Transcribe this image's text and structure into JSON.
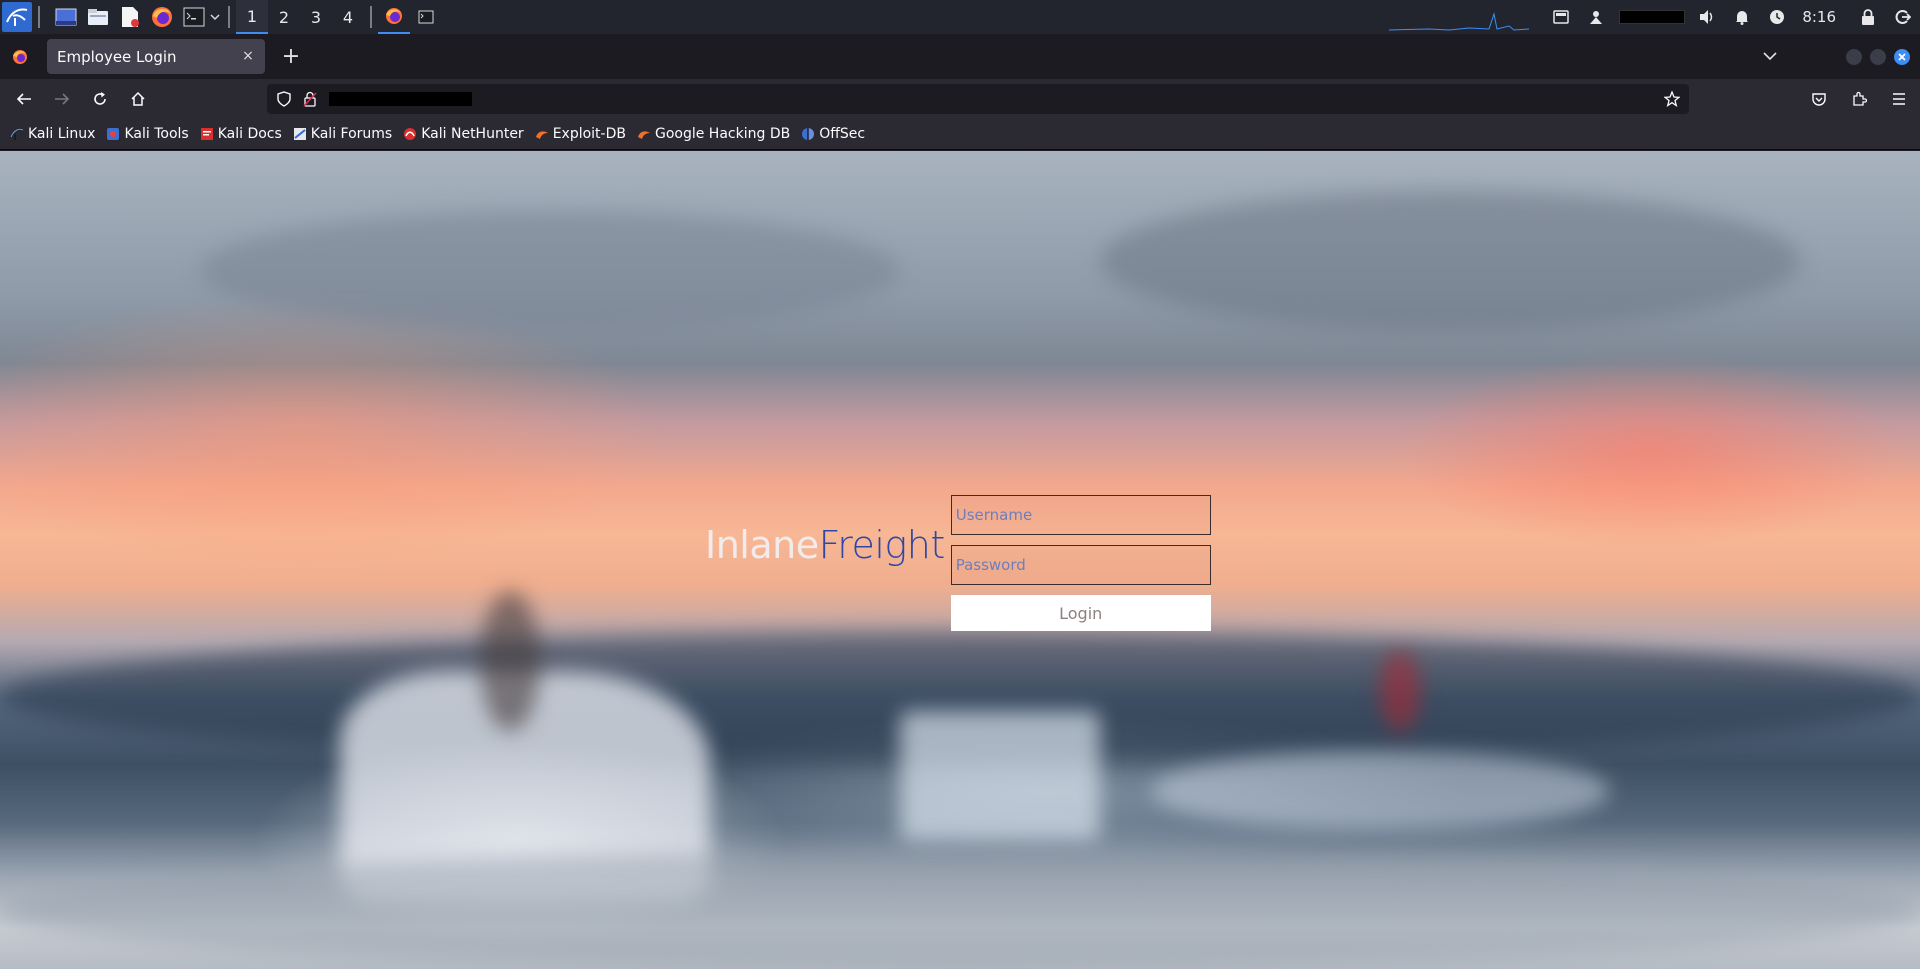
{
  "panel": {
    "workspaces": [
      "1",
      "2",
      "3",
      "4"
    ],
    "active_workspace": "1",
    "clock": "8:16",
    "icons": [
      "kali-menu-icon",
      "desktop-icon",
      "file-manager-icon",
      "text-editor-icon",
      "firefox-icon",
      "terminal-icon",
      "chevron-down-icon",
      "firefox-task-icon",
      "terminal-task-icon",
      "screenshot-icon",
      "vpn-icon",
      "volume-icon",
      "notification-bell-icon",
      "power-manager-icon",
      "lock-icon",
      "logout-icon"
    ],
    "accent": "#3d8df5"
  },
  "browser": {
    "tab_title": "Employee Login",
    "new_tab": "+",
    "close_glyph": "×",
    "bookmarks": [
      {
        "label": "Kali Linux",
        "icon": "kali-icon"
      },
      {
        "label": "Kali Tools",
        "icon": "kali-tools-icon"
      },
      {
        "label": "Kali Docs",
        "icon": "kali-docs-icon"
      },
      {
        "label": "Kali Forums",
        "icon": "kali-forums-icon"
      },
      {
        "label": "Kali NetHunter",
        "icon": "nethunter-icon"
      },
      {
        "label": "Exploit-DB",
        "icon": "exploit-db-icon"
      },
      {
        "label": "Google Hacking DB",
        "icon": "ghdb-icon"
      },
      {
        "label": "OffSec",
        "icon": "offsec-icon"
      }
    ]
  },
  "page": {
    "brand_part1": "Inlane",
    "brand_part2": "Freight",
    "username_placeholder": "Username",
    "password_placeholder": "Password",
    "login_label": "Login",
    "brand_color": "#2e46a6"
  }
}
